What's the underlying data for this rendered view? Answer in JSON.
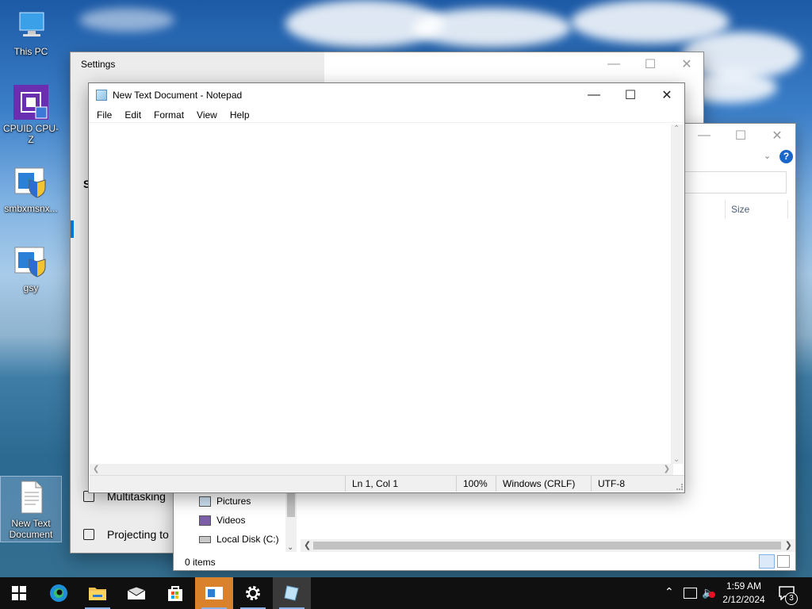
{
  "desktop": {
    "icons": [
      {
        "label": "This PC"
      },
      {
        "label": "CPUID CPU-Z"
      },
      {
        "label": "smbxmsnx..."
      },
      {
        "label": "gsy"
      },
      {
        "label": "New Text Document"
      }
    ]
  },
  "settings": {
    "title": "Settings",
    "nav": {
      "multitasking": "Multitasking",
      "projecting": "Projecting to"
    },
    "partial_letter_s": "S"
  },
  "explorer": {
    "column_size": "Size",
    "nav_items": [
      {
        "label": "Pictures",
        "icon": "pictures-icon"
      },
      {
        "label": "Videos",
        "icon": "videos-icon"
      },
      {
        "label": "Local Disk (C:)",
        "icon": "drive-icon"
      }
    ],
    "status_items": "0 items"
  },
  "notepad": {
    "title": "New Text Document - Notepad",
    "menu": {
      "file": "File",
      "edit": "Edit",
      "format": "Format",
      "view": "View",
      "help": "Help"
    },
    "content": "",
    "status": {
      "position": "Ln 1, Col 1",
      "zoom": "100%",
      "line_ending": "Windows (CRLF)",
      "encoding": "UTF-8"
    }
  },
  "taskbar": {
    "time": "1:59 AM",
    "date": "2/12/2024",
    "notification_count": "3"
  },
  "colors": {
    "taskbar": "#101010",
    "accent": "#0078d7",
    "settings_sidebar": "#ececec"
  }
}
